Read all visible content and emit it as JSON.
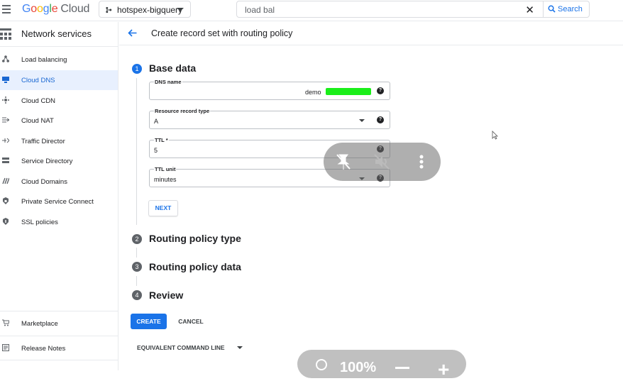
{
  "topbar": {
    "logo_google": "Google",
    "logo_cloud": "Cloud",
    "project": "hotspex-bigquery",
    "search_value": "load bal",
    "search_button": "Search"
  },
  "sidebar": {
    "title": "Network services",
    "items": [
      {
        "label": "Load balancing",
        "icon": "load-balancing-icon"
      },
      {
        "label": "Cloud DNS",
        "icon": "dns-icon",
        "active": true
      },
      {
        "label": "Cloud CDN",
        "icon": "cdn-icon"
      },
      {
        "label": "Cloud NAT",
        "icon": "nat-icon"
      },
      {
        "label": "Traffic Director",
        "icon": "traffic-director-icon"
      },
      {
        "label": "Service Directory",
        "icon": "service-directory-icon"
      },
      {
        "label": "Cloud Domains",
        "icon": "domains-icon"
      },
      {
        "label": "Private Service Connect",
        "icon": "psc-icon"
      },
      {
        "label": "SSL policies",
        "icon": "ssl-icon"
      }
    ],
    "bottom": [
      {
        "label": "Marketplace",
        "icon": "marketplace-icon"
      },
      {
        "label": "Release Notes",
        "icon": "release-notes-icon"
      }
    ]
  },
  "page": {
    "title": "Create record set with routing policy"
  },
  "steps": [
    {
      "num": "1",
      "title": "Base data"
    },
    {
      "num": "2",
      "title": "Routing policy type"
    },
    {
      "num": "3",
      "title": "Routing policy data"
    },
    {
      "num": "4",
      "title": "Review"
    }
  ],
  "form": {
    "dns_name_label": "DNS name",
    "dns_name_value": "demo",
    "rrtype_label": "Resource record type",
    "rrtype_value": "A",
    "ttl_label": "TTL *",
    "ttl_value": "5",
    "ttl_unit_label": "TTL unit",
    "ttl_unit_value": "minutes",
    "help_glyph": "?"
  },
  "buttons": {
    "next": "NEXT",
    "create": "CREATE",
    "cancel": "CANCEL",
    "equivalent": "EQUIVALENT COMMAND LINE"
  },
  "zoom": {
    "level": "100%"
  },
  "colors": {
    "accent": "#1a73e8",
    "active_bg": "#e8f0fe",
    "redaction": "#1aee1a"
  }
}
